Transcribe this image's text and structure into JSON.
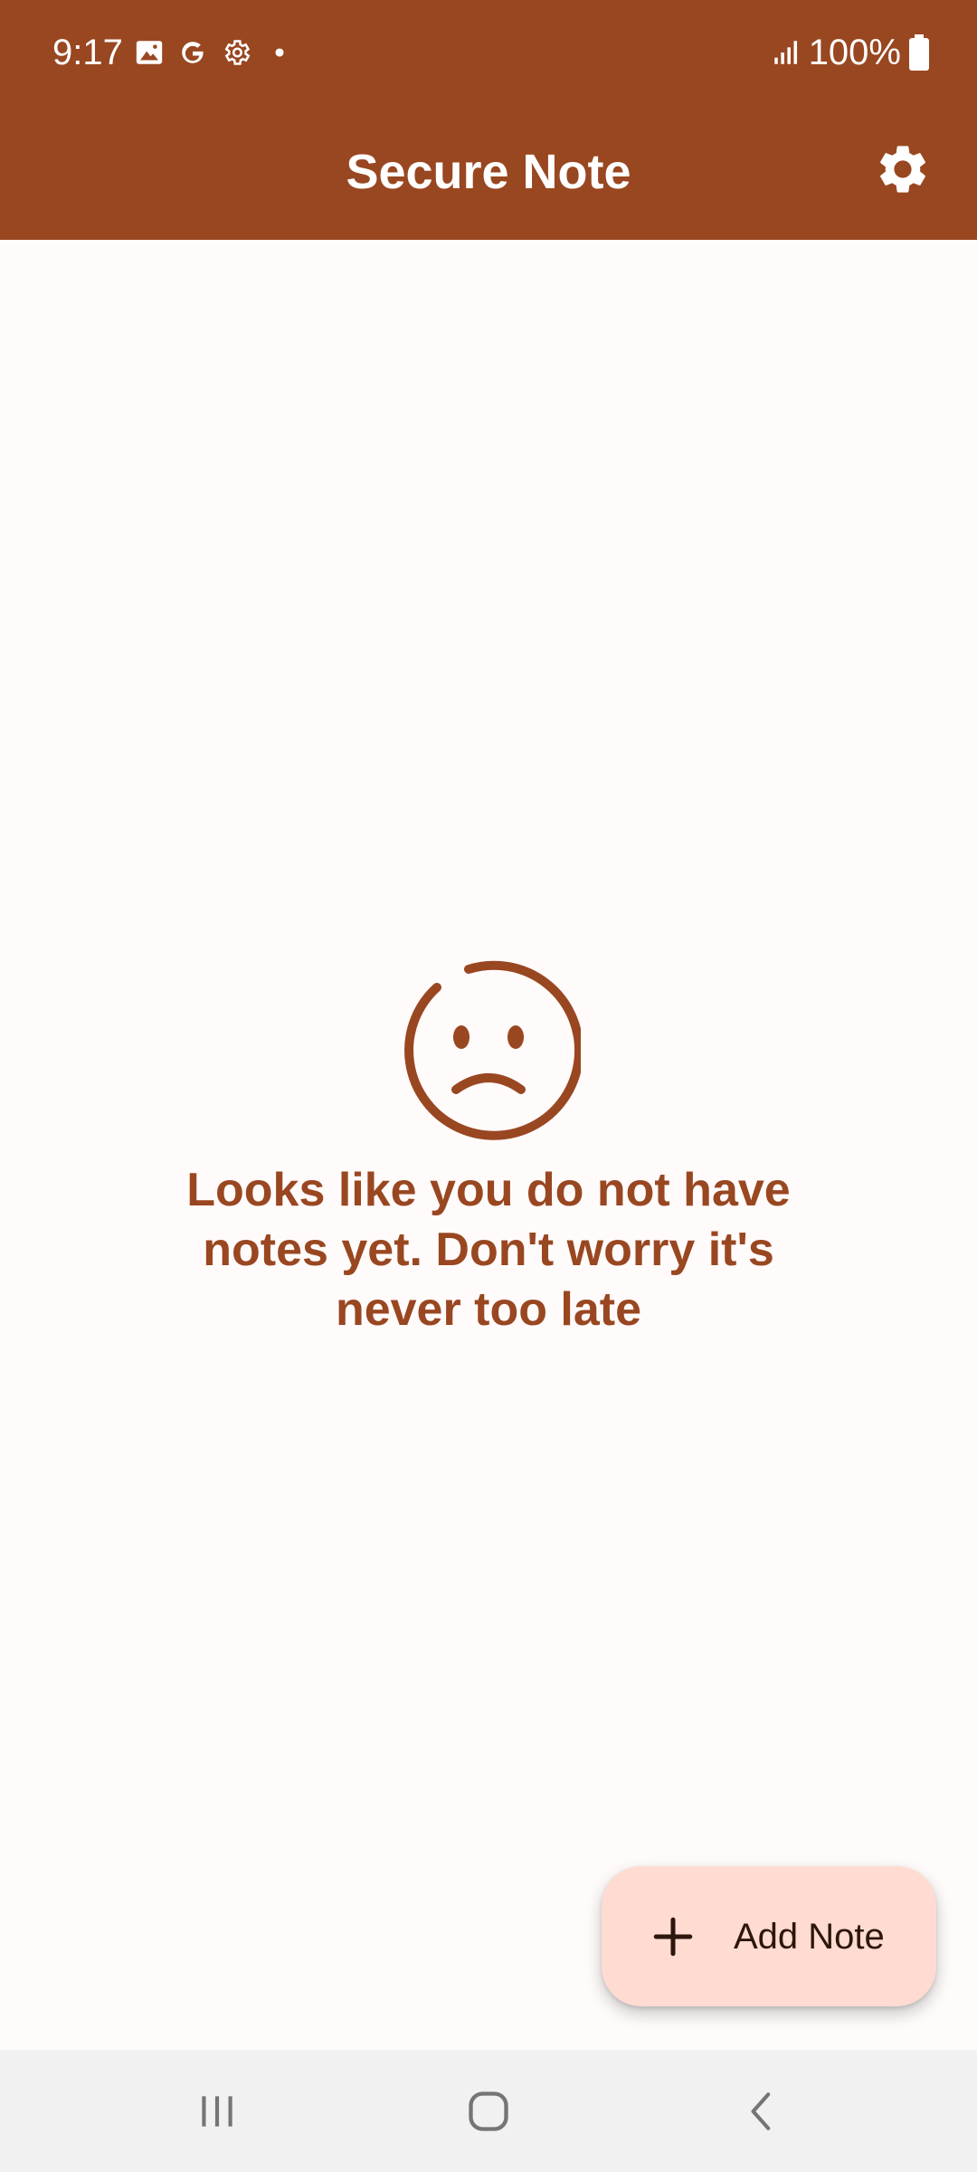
{
  "status_bar": {
    "time": "9:17",
    "battery": "100%",
    "icons": [
      "image-icon",
      "google-icon",
      "settings-gear-icon",
      "dot-icon",
      "signal-icon",
      "battery-icon"
    ]
  },
  "app_bar": {
    "title": "Secure Note",
    "settings_icon": "gear-icon"
  },
  "empty_state": {
    "icon": "sad-face-icon",
    "message": "Looks like you do not have notes yet. Don't worry it's never too late"
  },
  "fab": {
    "icon": "plus-icon",
    "label": "Add Note"
  },
  "nav_bar": {
    "buttons": [
      "recents-icon",
      "home-icon",
      "back-icon"
    ]
  },
  "colors": {
    "primary": "#994721",
    "background": "#fffbfb",
    "fab_background": "#ffdbd1",
    "nav_background": "#f2f1f2"
  }
}
